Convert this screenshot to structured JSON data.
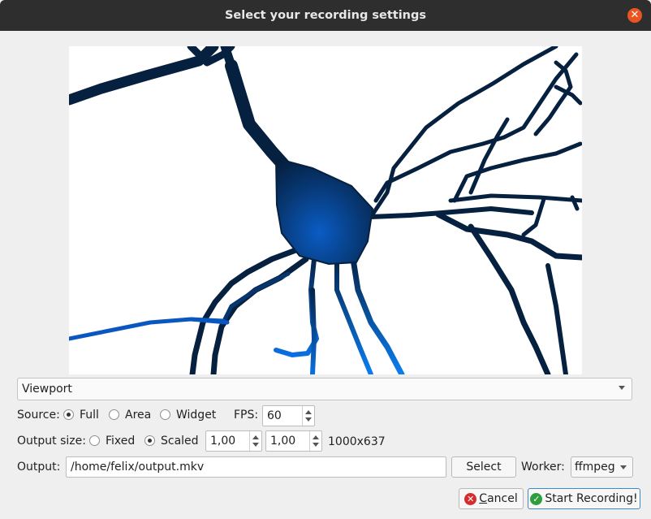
{
  "window": {
    "title": "Select your recording settings"
  },
  "source_combo": {
    "value": "Viewport"
  },
  "source": {
    "label": "Source:",
    "options": [
      "Full",
      "Area",
      "Widget"
    ],
    "selected": "Full",
    "fps_label": "FPS:",
    "fps_value": "60"
  },
  "output_size": {
    "label": "Output size:",
    "options": [
      "Fixed",
      "Scaled"
    ],
    "selected": "Scaled",
    "scale_x": "1,00",
    "scale_y": "1,00",
    "resolution": "1000x637"
  },
  "output": {
    "label": "Output:",
    "path": "/home/felix/output.mkv",
    "select_label": "Select",
    "worker_label": "Worker:",
    "worker_value": "ffmpeg"
  },
  "actions": {
    "cancel_mnemonic": "C",
    "cancel_rest": "ancel",
    "start_label": "Start Recording!"
  },
  "colors": {
    "titlebar": "#2e2e2e",
    "close": "#e95420",
    "neuron_dark": "#06213f",
    "neuron_bright": "#0a6fe0",
    "cancel_icon": "#d32f2f",
    "start_icon": "#2e9e3f"
  }
}
